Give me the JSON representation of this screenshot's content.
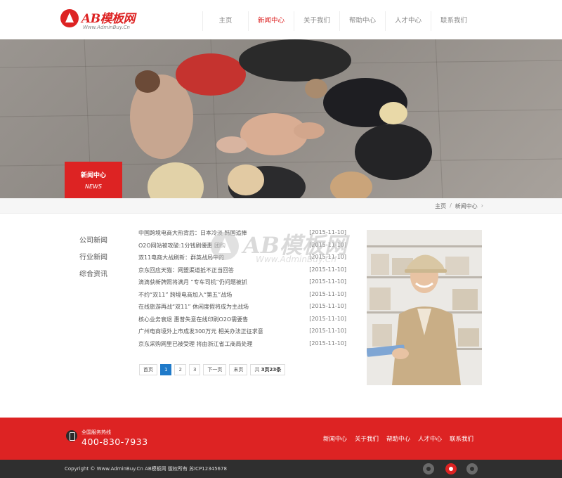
{
  "header": {
    "logo_name": "AB模板网",
    "logo_url": "Www.AdminBuy.Cn",
    "nav": [
      {
        "label": "主页"
      },
      {
        "label": "新闻中心",
        "active": true
      },
      {
        "label": "关于我们"
      },
      {
        "label": "帮助中心"
      },
      {
        "label": "人才中心"
      },
      {
        "label": "联系我们"
      }
    ]
  },
  "banner": {
    "tag_title": "新闻中心",
    "tag_sub": "NEWS"
  },
  "breadcrumb": {
    "home": "主页",
    "separator": "/",
    "current": "新闻中心",
    "arrow": "›"
  },
  "sidebar": {
    "items": [
      {
        "label": "公司新闻"
      },
      {
        "label": "行业新闻"
      },
      {
        "label": "综合资讯"
      }
    ]
  },
  "news": {
    "items": [
      {
        "title": "中国跨境电商大热背后：日本冷淡 韩国追捧",
        "date": "[2015-11-10]"
      },
      {
        "title": "O2O网站被攻破:1分钱刷優惠 团购",
        "date": "[2015-11-10]"
      },
      {
        "title": "双11电商大战刷新：群英战局中的",
        "date": "[2015-11-10]"
      },
      {
        "title": "京东回应天猫：网盟渠道抵不正当回答",
        "date": "[2015-11-10]"
      },
      {
        "title": "滴滴获新牌照将满月 “专车司机”仍问题被抓",
        "date": "[2015-11-10]"
      },
      {
        "title": "不约“双11” 跨境电商加入“第五”战场",
        "date": "[2015-11-10]"
      },
      {
        "title": "在线旅游再战“双11” 休闲度假将成为主战场",
        "date": "[2015-11-10]"
      },
      {
        "title": "核心业务衰退 惠普失意在线印刷O2O需要售",
        "date": "[2015-11-10]"
      },
      {
        "title": "广州电商境外上市成发300万元 相关办法正征求意",
        "date": "[2015-11-10]"
      },
      {
        "title": "京东采购网里已被受理 将由浙江省工商局处理",
        "date": "[2015-11-10]"
      }
    ],
    "pager": {
      "first": "首页",
      "pages": [
        "1",
        "2",
        "3"
      ],
      "current": "1",
      "next": "下一页",
      "last": "末页",
      "info_prefix": "共 ",
      "info_pages": "3页",
      "info_count": "23条"
    }
  },
  "watermark": {
    "text": "AB模板网",
    "url": "Www.AdminBuy.Cn"
  },
  "footer": {
    "hotline_label": "全国服务热线",
    "hotline_number": "400-830-7933",
    "nav": [
      {
        "label": "新闻中心"
      },
      {
        "label": "关于我们"
      },
      {
        "label": "帮助中心"
      },
      {
        "label": "人才中心"
      },
      {
        "label": "联系我们"
      }
    ],
    "copyright": "Copyright © Www.AdminBuy.Cn AB模板网 版权所有 苏ICP12345678"
  },
  "colors": {
    "accent": "#dd2323",
    "pager_active": "#1f7ac9",
    "footer_dark": "#2f2f2f"
  },
  "icons": {
    "phone": "phone-icon",
    "social": [
      "qq-icon",
      "wechat-icon",
      "weibo-icon"
    ]
  }
}
